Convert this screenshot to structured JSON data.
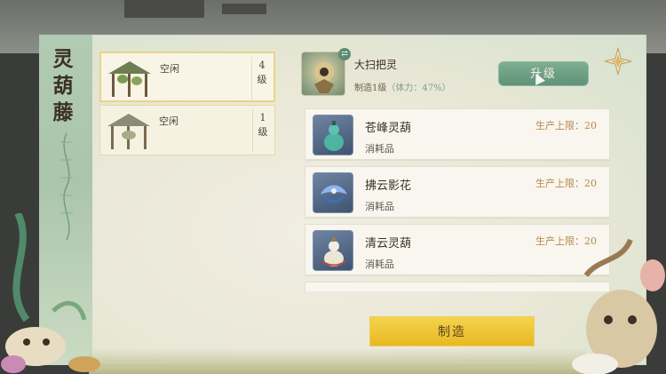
{
  "panel": {
    "title_chars": [
      "灵",
      "葫",
      "藤"
    ]
  },
  "buildings": [
    {
      "state": "空闲",
      "level": "4\n级",
      "active": true
    },
    {
      "state": "空闲",
      "level": "1\n级",
      "active": false
    }
  ],
  "spirit": {
    "name": "大扫把灵",
    "sub_prefix": "制造1级",
    "stamina": "（体力：47%）",
    "swap_icon": "swap-arrows-icon",
    "upgrade_label": "升级"
  },
  "items": [
    {
      "name": "苍峰灵葫",
      "type": "消耗品",
      "limit_label": "生产上限：",
      "limit_value": "20",
      "icon": "jade-gourd-icon",
      "icon_color": "#3f8f85"
    },
    {
      "name": "拂云影花",
      "type": "消耗品",
      "limit_label": "生产上限：",
      "limit_value": "20",
      "icon": "blue-flower-icon",
      "icon_color": "#5a7fc4"
    },
    {
      "name": "清云灵葫",
      "type": "消耗品",
      "limit_label": "生产上限：",
      "limit_value": "20",
      "icon": "white-gourd-icon",
      "icon_color": "#d8d2c2"
    }
  ],
  "make_label": "制造",
  "colors": {
    "accent_green": "#5f9278",
    "gold_button": "#e9b821",
    "limit_text": "#b9884c"
  }
}
